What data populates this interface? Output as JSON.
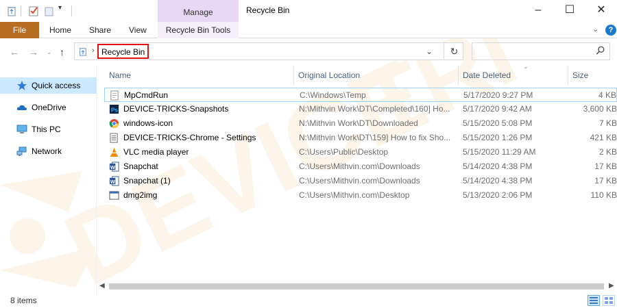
{
  "titlebar": {
    "manage_label": "Manage",
    "window_title": "Recycle Bin"
  },
  "ribbon": {
    "tabs": [
      "File",
      "Home",
      "Share",
      "View",
      "Recycle Bin Tools"
    ]
  },
  "address": {
    "path": "Recycle Bin"
  },
  "nav": {
    "items": [
      "Quick access",
      "OneDrive",
      "This PC",
      "Network"
    ]
  },
  "columns": [
    "Name",
    "Original Location",
    "Date Deleted",
    "Size"
  ],
  "files": [
    {
      "name": "MpCmdRun",
      "location": "C:\\Windows\\Temp",
      "date": "5/17/2020 9:27 PM",
      "size": "4 KB",
      "icon": "text-file-icon"
    },
    {
      "name": "DEVICE-TRICKS-Snapshots",
      "location": "N:\\Mithvin Work\\DT\\Completed\\160] Ho...",
      "date": "5/17/2020 9:42 AM",
      "size": "3,600 KB",
      "icon": "photoshop-file-icon"
    },
    {
      "name": "windows-icon",
      "location": "N:\\Mithvin Work\\DT\\Downloaded",
      "date": "5/15/2020 5:08 PM",
      "size": "7 KB",
      "icon": "chrome-file-icon"
    },
    {
      "name": "DEVICE-TRICKS-Chrome - Settings",
      "location": "N:\\Mithvin Work\\DT\\159] How to fix Sho...",
      "date": "5/15/2020 1:26 PM",
      "size": "421 KB",
      "icon": "document-file-icon"
    },
    {
      "name": "VLC media player",
      "location": "C:\\Users\\Public\\Desktop",
      "date": "5/15/2020 11:29 AM",
      "size": "2 KB",
      "icon": "vlc-icon"
    },
    {
      "name": "Snapchat",
      "location": "C:\\Users\\Mithvin.com\\Downloads",
      "date": "5/14/2020 4:38 PM",
      "size": "17 KB",
      "icon": "word-file-icon"
    },
    {
      "name": "Snapchat (1)",
      "location": "C:\\Users\\Mithvin.com\\Downloads",
      "date": "5/14/2020 4:38 PM",
      "size": "17 KB",
      "icon": "word-file-icon"
    },
    {
      "name": "dmg2img",
      "location": "C:\\Users\\Mithvin.com\\Desktop",
      "date": "5/13/2020 2:06 PM",
      "size": "110 KB",
      "icon": "application-icon"
    }
  ],
  "status": {
    "item_count": "8 items"
  },
  "colors": {
    "file_tab": "#b86d25",
    "manage_tab": "#e9d8f4",
    "selection": "#cce8ff",
    "highlight_box": "#e01010",
    "header_text": "#4c607a"
  }
}
